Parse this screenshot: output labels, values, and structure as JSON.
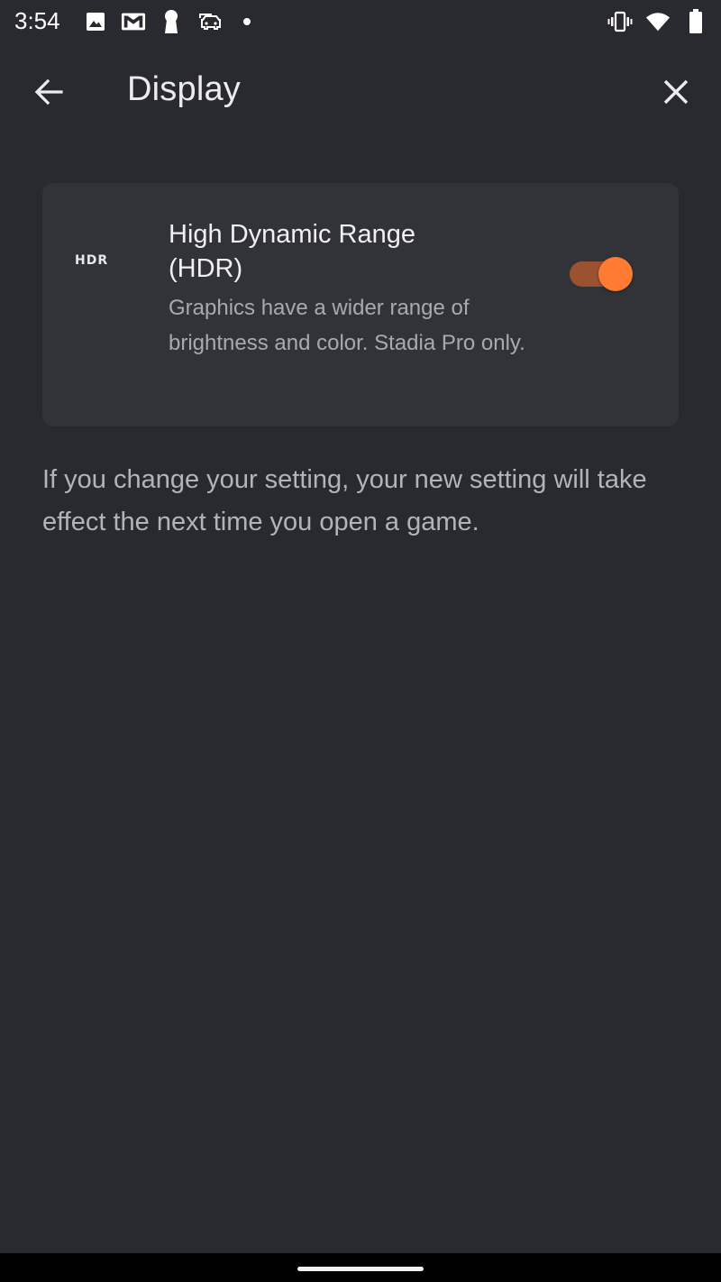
{
  "status_bar": {
    "time": "3:54",
    "left_icons": [
      "image-icon",
      "gmail-icon",
      "keyhole-icon",
      "car-icon",
      "dot-icon"
    ],
    "right_icons": [
      "vibrate-icon",
      "wifi-icon",
      "battery-icon"
    ]
  },
  "app_bar": {
    "title": "Display",
    "back_icon": "arrow-left-icon",
    "close_icon": "close-icon"
  },
  "setting": {
    "badge": "HDR",
    "title": "High Dynamic Range (HDR)",
    "description": "Graphics have a wider range of brightness and color. Stadia Pro only.",
    "enabled": true
  },
  "info": {
    "text": "If you change your setting, your new setting will take effect the next time you open a game."
  },
  "colors": {
    "background": "#292a2f",
    "card": "#323338",
    "accent": "#ff7a33",
    "accent_track": "#9a5231"
  }
}
